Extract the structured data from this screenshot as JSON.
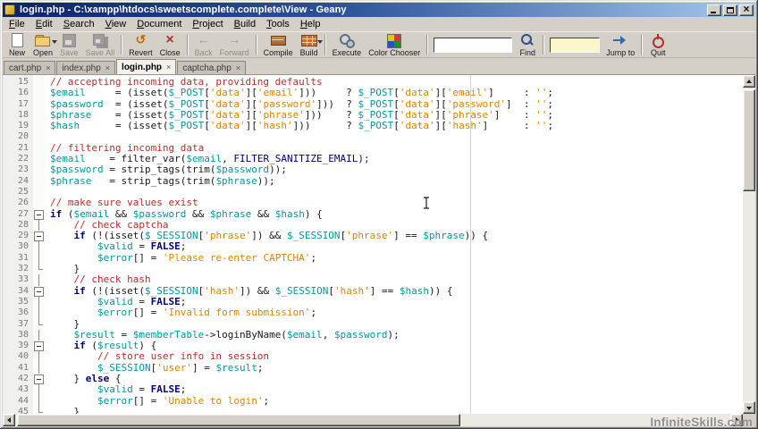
{
  "window": {
    "title": "login.php - C:\\xampp\\htdocs\\sweetscomplete.complete\\View - Geany"
  },
  "menu": {
    "items": [
      "File",
      "Edit",
      "Search",
      "View",
      "Document",
      "Project",
      "Build",
      "Tools",
      "Help"
    ]
  },
  "toolbar": {
    "items": [
      {
        "type": "button",
        "label": "New",
        "icon": "new-document-icon",
        "enabled": true
      },
      {
        "type": "button",
        "label": "Open",
        "icon": "open-folder-icon",
        "enabled": true,
        "dropdown": true
      },
      {
        "type": "button",
        "label": "Save",
        "icon": "save-disk-icon",
        "enabled": false
      },
      {
        "type": "button",
        "label": "Save All",
        "icon": "save-all-icon",
        "enabled": false
      },
      {
        "type": "sep"
      },
      {
        "type": "button",
        "label": "Revert",
        "icon": "revert-icon",
        "enabled": true
      },
      {
        "type": "button",
        "label": "Close",
        "icon": "close-document-icon",
        "enabled": true
      },
      {
        "type": "sep"
      },
      {
        "type": "button",
        "label": "Back",
        "icon": "back-arrow-icon",
        "enabled": false
      },
      {
        "type": "button",
        "label": "Forward",
        "icon": "forward-arrow-icon",
        "enabled": false
      },
      {
        "type": "sep"
      },
      {
        "type": "button",
        "label": "Compile",
        "icon": "compile-icon",
        "enabled": true
      },
      {
        "type": "button",
        "label": "Build",
        "icon": "build-brick-icon",
        "enabled": true,
        "dropdown": true
      },
      {
        "type": "sep"
      },
      {
        "type": "button",
        "label": "Execute",
        "icon": "execute-gears-icon",
        "enabled": true
      },
      {
        "type": "button",
        "label": "Color Chooser",
        "icon": "color-chooser-icon",
        "enabled": true
      },
      {
        "type": "sep"
      },
      {
        "type": "entry",
        "name": "search",
        "value": "",
        "placeholder": ""
      },
      {
        "type": "button",
        "label": "Find",
        "icon": "find-magnifier-icon",
        "enabled": true
      },
      {
        "type": "sep"
      },
      {
        "type": "entry",
        "name": "goto-line",
        "value": "",
        "placeholder": ""
      },
      {
        "type": "button",
        "label": "Jump to",
        "icon": "jump-to-icon",
        "enabled": true
      },
      {
        "type": "sep"
      },
      {
        "type": "button",
        "label": "Quit",
        "icon": "quit-icon",
        "enabled": true
      }
    ]
  },
  "tabs": [
    {
      "label": "cart.php",
      "active": false
    },
    {
      "label": "index.php",
      "active": false
    },
    {
      "label": "login.php",
      "active": true
    },
    {
      "label": "captcha.php",
      "active": false
    }
  ],
  "editor": {
    "language": "PHP",
    "lines": [
      {
        "n": 15,
        "f": "",
        "s": [
          [
            "c",
            "// accepting incoming data, providing defaults"
          ]
        ]
      },
      {
        "n": 16,
        "f": "",
        "s": [
          [
            "v",
            "$email"
          ],
          [
            "d",
            "     = (isset("
          ],
          [
            "v",
            "$_POST"
          ],
          [
            "d",
            "["
          ],
          [
            "s",
            "'data'"
          ],
          [
            "d",
            "]["
          ],
          [
            "s",
            "'email'"
          ],
          [
            "d",
            "]))     ? "
          ],
          [
            "v",
            "$_POST"
          ],
          [
            "d",
            "["
          ],
          [
            "s",
            "'data'"
          ],
          [
            "d",
            "]["
          ],
          [
            "s",
            "'email'"
          ],
          [
            "d",
            "]     : "
          ],
          [
            "s",
            "''"
          ],
          [
            "d",
            ";"
          ]
        ]
      },
      {
        "n": 17,
        "f": "",
        "s": [
          [
            "v",
            "$password"
          ],
          [
            "d",
            "  = (isset("
          ],
          [
            "v",
            "$_POST"
          ],
          [
            "d",
            "["
          ],
          [
            "s",
            "'data'"
          ],
          [
            "d",
            "]["
          ],
          [
            "s",
            "'password'"
          ],
          [
            "d",
            "]))  ? "
          ],
          [
            "v",
            "$_POST"
          ],
          [
            "d",
            "["
          ],
          [
            "s",
            "'data'"
          ],
          [
            "d",
            "]["
          ],
          [
            "s",
            "'password'"
          ],
          [
            "d",
            "]  : "
          ],
          [
            "s",
            "''"
          ],
          [
            "d",
            ";"
          ]
        ]
      },
      {
        "n": 18,
        "f": "",
        "s": [
          [
            "v",
            "$phrase"
          ],
          [
            "d",
            "    = (isset("
          ],
          [
            "v",
            "$_POST"
          ],
          [
            "d",
            "["
          ],
          [
            "s",
            "'data'"
          ],
          [
            "d",
            "]["
          ],
          [
            "s",
            "'phrase'"
          ],
          [
            "d",
            "]))    ? "
          ],
          [
            "v",
            "$_POST"
          ],
          [
            "d",
            "["
          ],
          [
            "s",
            "'data'"
          ],
          [
            "d",
            "]["
          ],
          [
            "s",
            "'phrase'"
          ],
          [
            "d",
            "]    : "
          ],
          [
            "s",
            "''"
          ],
          [
            "d",
            ";"
          ]
        ]
      },
      {
        "n": 19,
        "f": "",
        "s": [
          [
            "v",
            "$hash"
          ],
          [
            "d",
            "      = (isset("
          ],
          [
            "v",
            "$_POST"
          ],
          [
            "d",
            "["
          ],
          [
            "s",
            "'data'"
          ],
          [
            "d",
            "]["
          ],
          [
            "s",
            "'hash'"
          ],
          [
            "d",
            "]))      ? "
          ],
          [
            "v",
            "$_POST"
          ],
          [
            "d",
            "["
          ],
          [
            "s",
            "'data'"
          ],
          [
            "d",
            "]["
          ],
          [
            "s",
            "'hash'"
          ],
          [
            "d",
            "]      : "
          ],
          [
            "s",
            "''"
          ],
          [
            "d",
            ";"
          ]
        ]
      },
      {
        "n": 20,
        "f": "",
        "s": []
      },
      {
        "n": 21,
        "f": "",
        "s": [
          [
            "c",
            "// filtering incoming data"
          ]
        ]
      },
      {
        "n": 22,
        "f": "",
        "s": [
          [
            "v",
            "$email"
          ],
          [
            "d",
            "    = filter_var("
          ],
          [
            "v",
            "$email"
          ],
          [
            "d",
            ", "
          ],
          [
            "u",
            "FILTER_SANITIZE_EMAIL"
          ],
          [
            "d",
            ");"
          ]
        ]
      },
      {
        "n": 23,
        "f": "",
        "s": [
          [
            "v",
            "$password"
          ],
          [
            "d",
            " = strip_tags(trim("
          ],
          [
            "v",
            "$password"
          ],
          [
            "d",
            "));"
          ]
        ]
      },
      {
        "n": 24,
        "f": "",
        "s": [
          [
            "v",
            "$phrase"
          ],
          [
            "d",
            "   = strip_tags(trim("
          ],
          [
            "v",
            "$phrase"
          ],
          [
            "d",
            "));"
          ]
        ]
      },
      {
        "n": 25,
        "f": "",
        "s": []
      },
      {
        "n": 26,
        "f": "",
        "s": [
          [
            "c",
            "// make sure values exist"
          ]
        ]
      },
      {
        "n": 27,
        "f": "box",
        "s": [
          [
            "k",
            "if"
          ],
          [
            "d",
            " ("
          ],
          [
            "v",
            "$email"
          ],
          [
            "d",
            " && "
          ],
          [
            "v",
            "$password"
          ],
          [
            "d",
            " && "
          ],
          [
            "v",
            "$phrase"
          ],
          [
            "d",
            " && "
          ],
          [
            "v",
            "$hash"
          ],
          [
            "d",
            ") {"
          ]
        ]
      },
      {
        "n": 28,
        "f": "line",
        "s": [
          [
            "d",
            "    "
          ],
          [
            "c",
            "// check captcha"
          ]
        ]
      },
      {
        "n": 29,
        "f": "box",
        "s": [
          [
            "d",
            "    "
          ],
          [
            "k",
            "if"
          ],
          [
            "d",
            " (!(isset("
          ],
          [
            "v",
            "$_SESSION"
          ],
          [
            "d",
            "["
          ],
          [
            "s",
            "'phrase'"
          ],
          [
            "d",
            "]) && "
          ],
          [
            "v",
            "$_SESSION"
          ],
          [
            "d",
            "["
          ],
          [
            "s",
            "'phrase'"
          ],
          [
            "d",
            "] == "
          ],
          [
            "v",
            "$phrase"
          ],
          [
            "d",
            ")) {"
          ]
        ]
      },
      {
        "n": 30,
        "f": "line",
        "s": [
          [
            "d",
            "        "
          ],
          [
            "v",
            "$valid"
          ],
          [
            "d",
            " = "
          ],
          [
            "k",
            "FALSE"
          ],
          [
            "d",
            ";"
          ]
        ]
      },
      {
        "n": 31,
        "f": "line",
        "s": [
          [
            "d",
            "        "
          ],
          [
            "v",
            "$error"
          ],
          [
            "d",
            "[] = "
          ],
          [
            "s",
            "'Please re-enter CAPTCHA'"
          ],
          [
            "d",
            ";"
          ]
        ]
      },
      {
        "n": 32,
        "f": "end",
        "s": [
          [
            "d",
            "    }"
          ]
        ]
      },
      {
        "n": 33,
        "f": "line",
        "s": [
          [
            "d",
            "    "
          ],
          [
            "c",
            "// check hash"
          ]
        ]
      },
      {
        "n": 34,
        "f": "box",
        "s": [
          [
            "d",
            "    "
          ],
          [
            "k",
            "if"
          ],
          [
            "d",
            " (!(isset("
          ],
          [
            "v",
            "$_SESSION"
          ],
          [
            "d",
            "["
          ],
          [
            "s",
            "'hash'"
          ],
          [
            "d",
            "]) && "
          ],
          [
            "v",
            "$_SESSION"
          ],
          [
            "d",
            "["
          ],
          [
            "s",
            "'hash'"
          ],
          [
            "d",
            "] == "
          ],
          [
            "v",
            "$hash"
          ],
          [
            "d",
            ")) {"
          ]
        ]
      },
      {
        "n": 35,
        "f": "line",
        "s": [
          [
            "d",
            "        "
          ],
          [
            "v",
            "$valid"
          ],
          [
            "d",
            " = "
          ],
          [
            "k",
            "FALSE"
          ],
          [
            "d",
            ";"
          ]
        ]
      },
      {
        "n": 36,
        "f": "line",
        "s": [
          [
            "d",
            "        "
          ],
          [
            "v",
            "$error"
          ],
          [
            "d",
            "[] = "
          ],
          [
            "s",
            "'Invalid form submission'"
          ],
          [
            "d",
            ";"
          ]
        ]
      },
      {
        "n": 37,
        "f": "end",
        "s": [
          [
            "d",
            "    }"
          ]
        ]
      },
      {
        "n": 38,
        "f": "line",
        "s": [
          [
            "d",
            "    "
          ],
          [
            "v",
            "$result"
          ],
          [
            "d",
            " = "
          ],
          [
            "v",
            "$memberTable"
          ],
          [
            "d",
            "->loginByName("
          ],
          [
            "v",
            "$email"
          ],
          [
            "d",
            ", "
          ],
          [
            "v",
            "$password"
          ],
          [
            "d",
            ");"
          ]
        ]
      },
      {
        "n": 39,
        "f": "box",
        "s": [
          [
            "d",
            "    "
          ],
          [
            "k",
            "if"
          ],
          [
            "d",
            " ("
          ],
          [
            "v",
            "$result"
          ],
          [
            "d",
            ") {"
          ]
        ]
      },
      {
        "n": 40,
        "f": "line",
        "s": [
          [
            "d",
            "        "
          ],
          [
            "c",
            "// store user info in session"
          ]
        ]
      },
      {
        "n": 41,
        "f": "line",
        "s": [
          [
            "d",
            "        "
          ],
          [
            "v",
            "$_SESSION"
          ],
          [
            "d",
            "["
          ],
          [
            "s",
            "'user'"
          ],
          [
            "d",
            "] = "
          ],
          [
            "v",
            "$result"
          ],
          [
            "d",
            ";"
          ]
        ]
      },
      {
        "n": 42,
        "f": "box",
        "s": [
          [
            "d",
            "    } "
          ],
          [
            "k",
            "else"
          ],
          [
            "d",
            " {"
          ]
        ]
      },
      {
        "n": 43,
        "f": "line",
        "s": [
          [
            "d",
            "        "
          ],
          [
            "v",
            "$valid"
          ],
          [
            "d",
            " = "
          ],
          [
            "k",
            "FALSE"
          ],
          [
            "d",
            ";"
          ]
        ]
      },
      {
        "n": 44,
        "f": "line",
        "s": [
          [
            "d",
            "        "
          ],
          [
            "v",
            "$error"
          ],
          [
            "d",
            "[] = "
          ],
          [
            "s",
            "'Unable to login'"
          ],
          [
            "d",
            ";"
          ]
        ]
      },
      {
        "n": 45,
        "f": "end",
        "s": [
          [
            "d",
            "    }"
          ]
        ]
      }
    ]
  },
  "watermark": "InfiniteSkills.com",
  "colors": {
    "title_gradient_start": "#0a246a",
    "title_gradient_end": "#a6caf0",
    "window_chrome": "#d4d0c8",
    "syntax_comment": "#c22a2a",
    "syntax_variable": "#009a9a",
    "syntax_string": "#dd8500",
    "syntax_keyword": "#00007f",
    "syntax_constant": "#00007f"
  }
}
